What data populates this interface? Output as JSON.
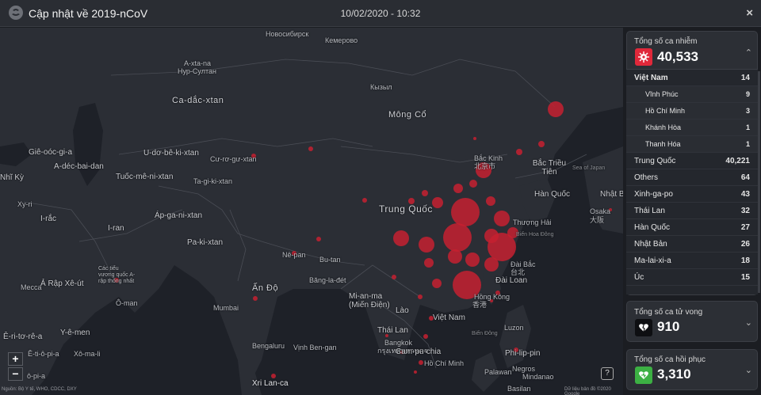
{
  "header": {
    "title": "Cập nhật về 2019-nCoV",
    "datetime": "10/02/2020 - 10:32",
    "close": "×"
  },
  "map": {
    "labels": {
      "novosibirsk": "Новосибирск",
      "kemerovo": "Кемерово",
      "kyzyl": "Кызыл",
      "a_xta_na": "A-xta-na",
      "nur_sultan": "Нур-Султан",
      "mong_co": "Mông Cổ",
      "ca_dac_xtan": "Ca-dắc-xtan",
      "gie_ooc_gi_a": "Giê-oóc-gi-a",
      "a_dec_bai_dan": "A-déc-bai-dan",
      "u_do_be_ki_xtan": "U-dơ-bê-ki-xtan",
      "tuoc_me_ni_xtan": "Tuốc-mê-ni-xtan",
      "cu_ro_gu_xtan": "Cư-rơ-gư-xtan",
      "tat_gi_ki_xtan": "Ta-gi-ki-xtan",
      "nhi_ky": "Nhĩ Kỳ",
      "xy_ri": "Xy-ri",
      "i_rac": "I-rắc",
      "i_ran": "I-ran",
      "ap_ga_ni_xtan": "Áp-ga-ni-xtan",
      "pa_ki_xtan": "Pa-ki-xtan",
      "ne_pan": "Nê-pan",
      "bu_tan": "Bu-tan",
      "bang_la_det": "Băng-la-đét",
      "an_do": "Ấn Độ",
      "mumbai": "Mumbai",
      "bengaluru": "Bengaluru",
      "xri_lan_ca": "Xri Lan-ca",
      "mecca": "Mecca",
      "a_rap_xe_ut": "Ả Rập Xê-út",
      "cac_tieu_vuong_quoc": "Các tiểu vương quốc A-rập thống nhất",
      "o_man": "Ô-man",
      "e_ri_to_re_a": "Ê-ri-tơ-rê-a",
      "y_e_men": "Y-ê-men",
      "e_ti_o_pi_a": "Ê-ti-ô-pi-a",
      "xo_ma_li": "Xô-ma-li",
      "o_pi_a": "ô-pi-a",
      "my_an_ma": "Mi-an-ma (Miến Điện)",
      "lao": "Lào",
      "thai_lan": "Thái Lan",
      "bangkok": "Bangkok",
      "bangkok_thai": "กรุงเทพมหานคร",
      "campuchia": "Cam-pu-chia",
      "viet_nam": "Việt Nam",
      "ho_chi_minh": "Hồ Chí Minh",
      "vinh_ben_gan": "Vịnh Ben-gan",
      "trung_quoc": "Trung Quốc",
      "bac_kinh": "Bắc Kinh",
      "bac_kinh_cn": "北京市",
      "bac_trieu_tien": "Bắc Triều Tiên",
      "han_quoc": "Hàn Quốc",
      "nhat_ban": "Nhật Bản",
      "osaka": "Osaka",
      "osaka_jp": "大阪",
      "sea_of_japan": "Sea of Japan",
      "thuong_hai": "Thượng Hải",
      "bien_hoa_dong": "Biển Hoa Đông",
      "dai_bac": "Đài Bắc",
      "dai_bac_cn": "台北",
      "dai_loan": "Đài Loan",
      "hong_kong": "Hồng Kông",
      "hong_kong_cn": "香港",
      "bien_dong": "Biển Đông",
      "luzon": "Luzon",
      "phi_lip_pin": "Phi-lip-pin",
      "palawan": "Palawan",
      "negros": "Negros",
      "mindanao": "Mindanao",
      "basilan": "Basilan"
    },
    "zoom_in": "+",
    "zoom_out": "−",
    "help": "?",
    "attribution_left": "Nguồn: Bộ Y tế, WHO, CDCC, DXY",
    "attribution_right": "Dữ liệu bản đồ ©2020 Google"
  },
  "infected": {
    "title": "Tổng số ca nhiễm",
    "value": "40,533",
    "icon": "virus-icon",
    "color": "#e0283a",
    "rows": [
      {
        "name": "Việt Nam",
        "num": "14",
        "sub": false,
        "bold": true
      },
      {
        "name": "Vĩnh Phúc",
        "num": "9",
        "sub": true
      },
      {
        "name": "Hồ Chí Minh",
        "num": "3",
        "sub": true
      },
      {
        "name": "Khánh Hòa",
        "num": "1",
        "sub": true
      },
      {
        "name": "Thanh Hóa",
        "num": "1",
        "sub": true
      },
      {
        "name": "Trung Quốc",
        "num": "40,221",
        "sub": false
      },
      {
        "name": "Others",
        "num": "64",
        "sub": false
      },
      {
        "name": "Xinh-ga-po",
        "num": "43",
        "sub": false
      },
      {
        "name": "Thái Lan",
        "num": "32",
        "sub": false
      },
      {
        "name": "Hàn Quốc",
        "num": "27",
        "sub": false
      },
      {
        "name": "Nhật Bản",
        "num": "26",
        "sub": false
      },
      {
        "name": "Ma-lai-xi-a",
        "num": "18",
        "sub": false
      },
      {
        "name": "Úc",
        "num": "15",
        "sub": false
      }
    ]
  },
  "deaths": {
    "title": "Tổng số ca tử vong",
    "value": "910",
    "icon": "broken-heart-icon",
    "color": "#0e0f12"
  },
  "recovered": {
    "title": "Tổng số ca hồi phục",
    "value": "3,310",
    "icon": "heart-icon",
    "color": "#3cb043"
  }
}
